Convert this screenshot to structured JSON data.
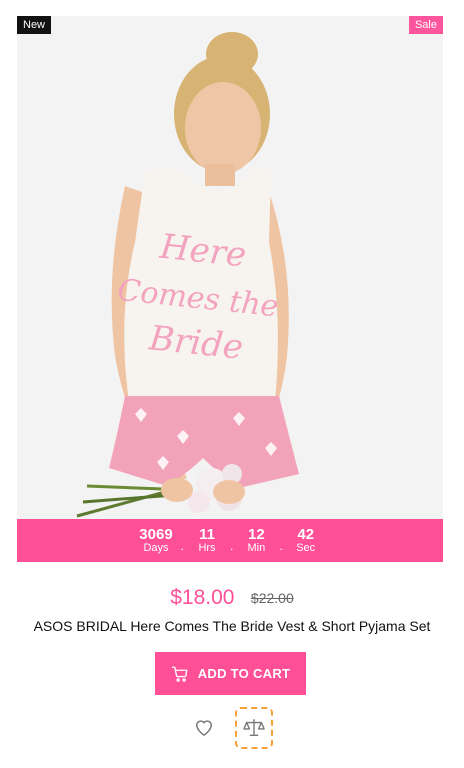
{
  "product": {
    "badges": {
      "new": "New",
      "sale": "Sale"
    },
    "countdown": {
      "days_value": "3069",
      "days_label": "Days",
      "hours_value": "11",
      "hours_label": "Hrs",
      "minutes_value": "12",
      "minutes_label": "Min",
      "seconds_value": "42",
      "seconds_label": "Sec",
      "separator": "."
    },
    "price": {
      "current": "$18.00",
      "original": "$22.00"
    },
    "title": "ASOS BRIDAL Here Comes The Bride Vest & Short Pyjama Set",
    "add_to_cart_label": "Add to cart",
    "tshirt_print": {
      "line1": "Here",
      "line2": "Comes the",
      "line3": "Bride"
    }
  },
  "colors": {
    "accent": "#ff4f97",
    "compare_outline": "#f4a238",
    "new_badge": "#111111"
  },
  "icons": {
    "cart": "shopping-cart-icon",
    "wishlist": "heart-icon",
    "compare": "scale-icon"
  }
}
